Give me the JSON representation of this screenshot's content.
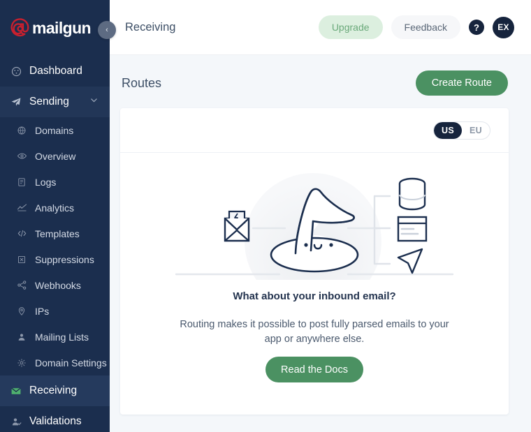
{
  "brand": {
    "logo_text": "mailgun",
    "logo_at_color": "#c8202e",
    "sidebar_bg": "#1b2e4e",
    "accent_green": "#4b9162"
  },
  "sidebar": {
    "items": [
      {
        "label": "Dashboard",
        "icon": "gauge-icon",
        "level": "top",
        "state": "normal"
      },
      {
        "label": "Sending",
        "icon": "paper-plane-icon",
        "level": "top",
        "state": "expanded",
        "chevron": "chevron-down-icon"
      },
      {
        "label": "Domains",
        "icon": "globe-icon",
        "level": "sub",
        "state": "normal"
      },
      {
        "label": "Overview",
        "icon": "eye-icon",
        "level": "sub",
        "state": "normal"
      },
      {
        "label": "Logs",
        "icon": "document-icon",
        "level": "sub",
        "state": "normal"
      },
      {
        "label": "Analytics",
        "icon": "chart-line-icon",
        "level": "sub",
        "state": "normal"
      },
      {
        "label": "Templates",
        "icon": "code-icon",
        "level": "sub",
        "state": "normal"
      },
      {
        "label": "Suppressions",
        "icon": "block-icon",
        "level": "sub",
        "state": "normal"
      },
      {
        "label": "Webhooks",
        "icon": "share-nodes-icon",
        "level": "sub",
        "state": "normal"
      },
      {
        "label": "IPs",
        "icon": "location-pin-icon",
        "level": "sub",
        "state": "normal"
      },
      {
        "label": "Mailing Lists",
        "icon": "user-icon",
        "level": "sub",
        "state": "normal"
      },
      {
        "label": "Domain Settings",
        "icon": "gear-icon",
        "level": "sub",
        "state": "normal"
      },
      {
        "label": "Receiving",
        "icon": "envelope-icon",
        "level": "top",
        "state": "active"
      },
      {
        "label": "Validations",
        "icon": "user-check-icon",
        "level": "top",
        "state": "normal"
      }
    ]
  },
  "topbar": {
    "page_name": "Receiving",
    "upgrade_label": "Upgrade",
    "feedback_label": "Feedback",
    "help_label": "?",
    "avatar_initials": "EX",
    "collapse_label": "‹"
  },
  "content": {
    "title": "Routes",
    "create_button": "Create Route",
    "region_toggle": {
      "options": [
        "US",
        "EU"
      ],
      "selected": "US"
    },
    "empty_state": {
      "title": "What about your inbound email?",
      "description": "Routing makes it possible to post fully parsed emails to your app or anywhere else.",
      "cta_label": "Read the Docs",
      "illustration": "wizard-hat-routing-illustration"
    }
  }
}
